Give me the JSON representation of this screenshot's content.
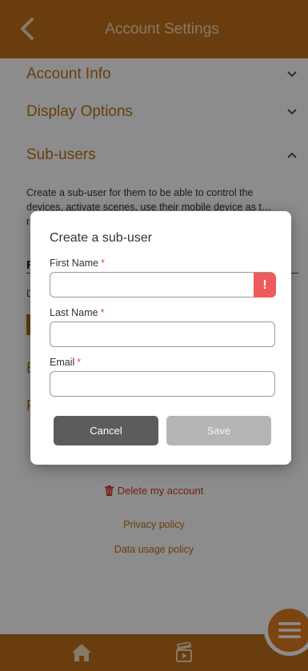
{
  "header": {
    "title": "Account Settings",
    "back_icon": "chevron-left-icon"
  },
  "sections": [
    {
      "label": "Account Info",
      "state": "collapsed"
    },
    {
      "label": "Display Options",
      "state": "collapsed"
    },
    {
      "label": "Sub-users",
      "state": "expanded"
    }
  ],
  "subusers": {
    "description": "Create a sub-user for them to be able to control the devices, activate scenes, use their mobile device as t… r…",
    "list_heading": "F",
    "list_desc": "D",
    "ghost_a": "E",
    "ghost_b": "F"
  },
  "links": {
    "delete_account": "Delete my account",
    "privacy_policy": "Privacy policy",
    "data_usage_policy": "Data usage policy"
  },
  "modal": {
    "title": "Create a sub-user",
    "first_name_label": "First Name",
    "last_name_label": "Last Name",
    "email_label": "Email",
    "required_mark": "*",
    "first_name_value": "",
    "last_name_value": "",
    "email_value": "",
    "error_mark": "!",
    "cancel_label": "Cancel",
    "save_label": "Save"
  },
  "footer": {
    "icons": [
      "home-icon",
      "scenes-clapperboard-icon",
      "menu-icon"
    ]
  },
  "colors": {
    "brand": "#c07018",
    "header_text": "#f6dcc0",
    "danger": "#d0342c",
    "error_badge": "#f05a5a"
  }
}
